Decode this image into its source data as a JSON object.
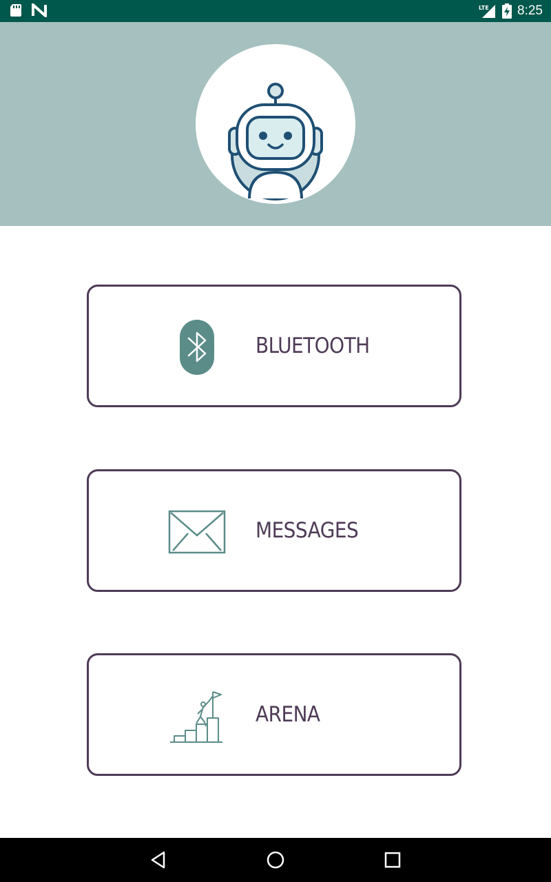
{
  "status_bar": {
    "time": "8:25",
    "network": "LTE",
    "icons": [
      "sd-card-icon",
      "n-notification-icon",
      "lte-signal-icon",
      "battery-charging-icon"
    ]
  },
  "header": {
    "avatar": "robot-avatar",
    "background_color": "#a5c0bf"
  },
  "menu": {
    "items": [
      {
        "label": "BLUETOOTH",
        "icon": "bluetooth-icon"
      },
      {
        "label": "MESSAGES",
        "icon": "envelope-icon"
      },
      {
        "label": "ARENA",
        "icon": "climber-flag-icon"
      }
    ]
  },
  "nav_bar": {
    "buttons": [
      "back",
      "home",
      "recents"
    ]
  },
  "colors": {
    "status_bar": "#00574b",
    "header": "#a5c0bf",
    "accent": "#5b8c88",
    "button_border": "#4e3b57",
    "button_text": "#4e3b57"
  }
}
